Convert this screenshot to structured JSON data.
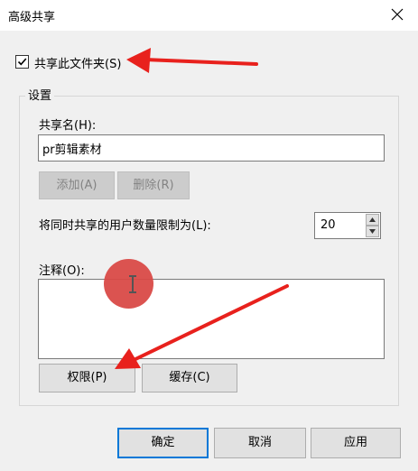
{
  "window": {
    "title": "高级共享"
  },
  "share": {
    "checkbox_label": "共享此文件夹(S)",
    "checked": true
  },
  "settings": {
    "legend": "设置",
    "share_name_label": "共享名(H):",
    "share_name_value": "pr剪辑素材",
    "add_label": "添加(A)",
    "delete_label": "删除(R)",
    "limit_label": "将同时共享的用户数量限制为(L):",
    "limit_value": "20",
    "comment_label": "注释(O):",
    "comment_value": "",
    "permissions_label": "权限(P)",
    "cache_label": "缓存(C)"
  },
  "footer": {
    "ok_label": "确定",
    "cancel_label": "取消",
    "apply_label": "应用"
  },
  "colors": {
    "annotation_red": "#e8211d",
    "highlight_dot": "#d94a47",
    "focus_blue": "#0078d7"
  }
}
